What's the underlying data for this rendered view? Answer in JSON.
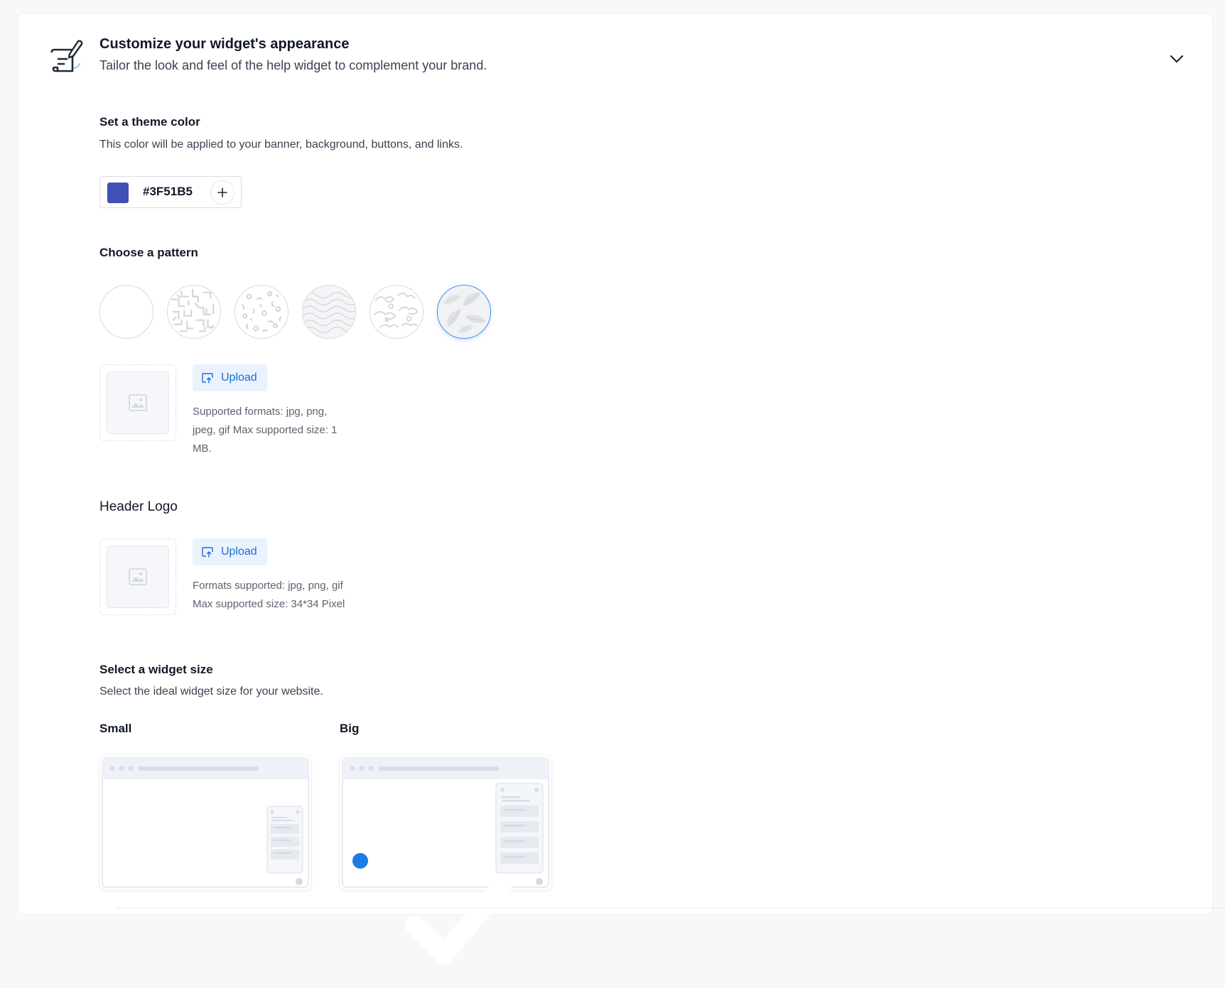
{
  "header": {
    "title": "Customize your widget's appearance",
    "subtitle": "Tailor the look and feel of the help widget to complement your brand.",
    "icon": "customize-icon",
    "collapse_icon": "chevron-down-icon"
  },
  "theme": {
    "label": "Set a theme color",
    "description": "This color will be applied to your banner, background, buttons, and links.",
    "color_value": "#3F51B5",
    "swatch_color": "#3F51B5",
    "add_icon": "plus-icon"
  },
  "pattern": {
    "label": "Choose a pattern",
    "options": [
      "none",
      "maze",
      "dots",
      "waves",
      "clouds",
      "leaves"
    ],
    "selected_index": 5,
    "upload": {
      "button_label": "Upload",
      "help_lines": [
        "Supported formats: jpg, png,",
        "jpeg, gif Max supported size: 1",
        "MB."
      ]
    }
  },
  "header_logo": {
    "label": "Header Logo",
    "upload": {
      "button_label": "Upload",
      "help_lines": [
        "Formats supported: jpg, png, gif",
        "Max supported size: 34*34 Pixel"
      ]
    }
  },
  "widget_size": {
    "label": "Select a widget size",
    "description": "Select the ideal widget size for your website.",
    "options": [
      {
        "label": "Small",
        "selected": false
      },
      {
        "label": "Big",
        "selected": true
      }
    ]
  },
  "colors": {
    "accent": "#1E7AE6",
    "upload_bg": "#E9F2FD"
  }
}
